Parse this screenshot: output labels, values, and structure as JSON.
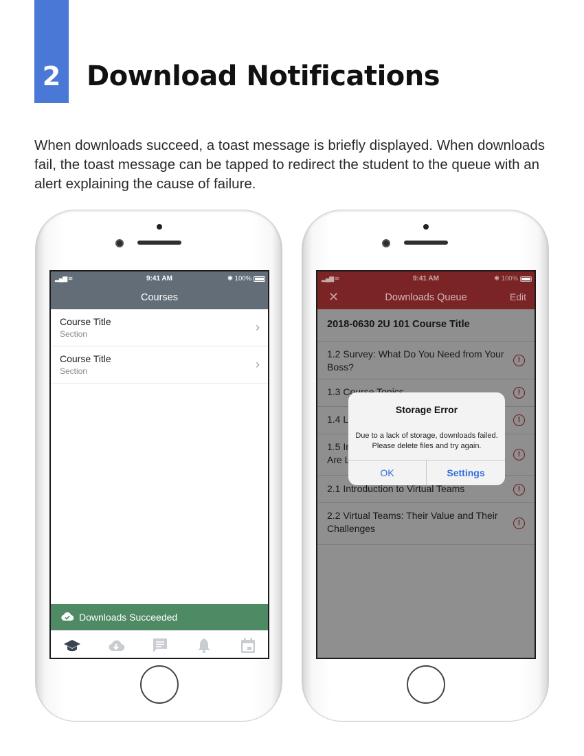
{
  "section": {
    "number": "2",
    "title": "Download Notifications",
    "intro": "When downloads succeed, a toast message is briefly displayed. When downloads fail, the toast message can be tapped to redirect the student to the queue with an alert explaining the cause of failure."
  },
  "colors": {
    "accent_blue": "#4a78d6",
    "courses_nav": "#636d78",
    "toast_green": "#4e8b64",
    "queue_nav": "#7a2426"
  },
  "phone_left": {
    "status": {
      "time": "9:41 AM",
      "battery": "100%"
    },
    "nav_title": "Courses",
    "courses": [
      {
        "title": "Course Title",
        "section": "Section"
      },
      {
        "title": "Course Title",
        "section": "Section"
      }
    ],
    "toast": {
      "icon": "cloud-check-icon",
      "text": "Downloads Succeeded"
    },
    "tabs": [
      "courses-icon",
      "downloads-icon",
      "messages-icon",
      "notifications-icon",
      "calendar-icon"
    ]
  },
  "phone_right": {
    "status": {
      "time": "9:41 AM",
      "battery": "100%"
    },
    "nav_title": "Downloads Queue",
    "close_label": "✕",
    "edit_label": "Edit",
    "course_header": "2018-0630 2U 101 Course Title",
    "queue": [
      {
        "title": "1.2 Survey: What Do You Need from Your Boss?"
      },
      {
        "title": "1.3 Course Topics"
      },
      {
        "title": "1.4 L"
      },
      {
        "title": "1.5 In Are L"
      },
      {
        "title": "2.1 Introduction to Virtual Teams"
      },
      {
        "title": "2.2 Virtual Teams: Their Value and Their Challenges"
      }
    ],
    "alert_glyph": "!",
    "dialog": {
      "title": "Storage Error",
      "message": "Due to a lack of storage, downloads failed. Please delete files and try again.",
      "ok": "OK",
      "settings": "Settings"
    }
  }
}
